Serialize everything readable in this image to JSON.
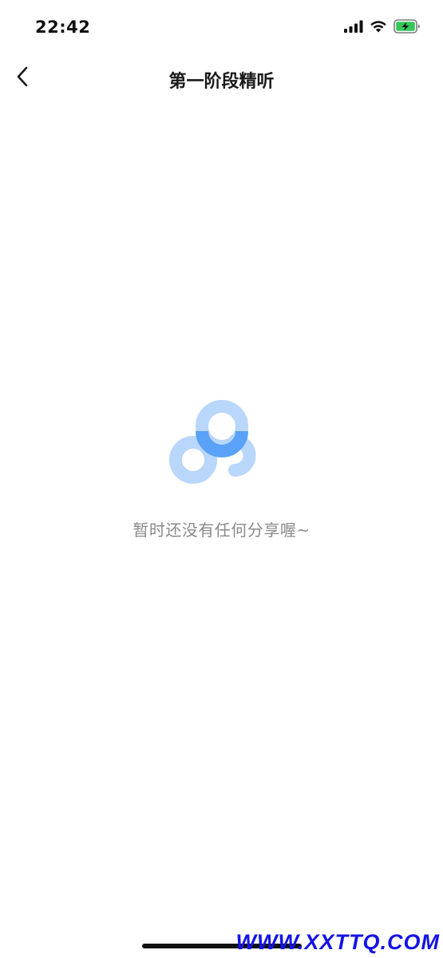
{
  "status_bar": {
    "time": "22:42",
    "signal_icon": "cellular-signal-icon",
    "wifi_icon": "wifi-icon",
    "battery_icon": "battery-charging-icon",
    "battery_color": "#34c759"
  },
  "nav": {
    "back_icon": "chevron-left-icon",
    "title": "第一阶段精听"
  },
  "empty_state": {
    "logo_icon": "baidu-netdisk-cloud-icon",
    "message": "暂时还没有任何分享喔~",
    "logo_light_color": "#b9d6fb",
    "logo_dark_color": "#5aa2f7"
  },
  "watermark": {
    "text": "WWW.XXTTQ.COM",
    "color": "#1414e6"
  }
}
